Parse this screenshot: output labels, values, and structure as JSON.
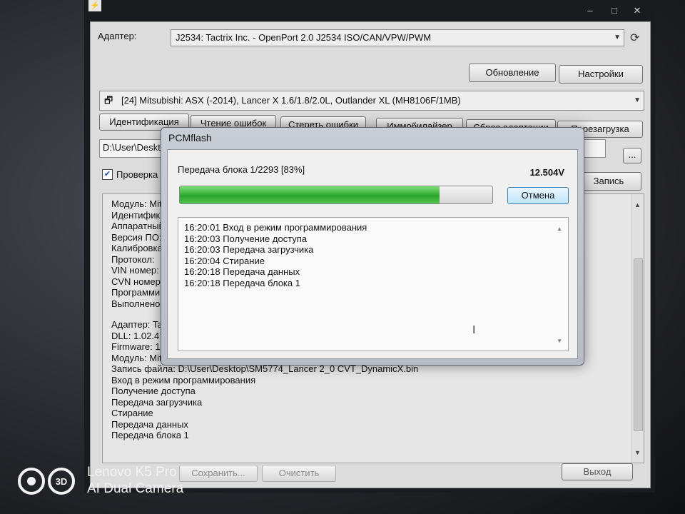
{
  "main": {
    "adapter_label": "Адаптер:",
    "adapter_value": "J2534: Tactrix Inc. - OpenPort 2.0 J2534 ISO/CAN/VPW/PWM",
    "update_button": "Обновление",
    "settings_button": "Настройки",
    "vehicle_value": "[24] Mitsubishi: ASX (-2014), Lancer X 1.6/1.8/2.0L, Outlander XL (MH8106F/1MB)",
    "tabs": [
      "Идентификация",
      "Чтение ошибок",
      "Стереть ошибки",
      "Иммобилайзер",
      "Сброс адаптации",
      "Перезагрузка"
    ],
    "path_value": "D:\\User\\Desktop",
    "browse_button": "...",
    "verify_checkbox_label": "Проверка",
    "write_button": "Запись",
    "log_lines_top": [
      "Модуль: Mits",
      "Идентифика",
      "Аппаратный",
      "Версия ПО:",
      "Калибровка:",
      "Протокол:",
      "VIN номер:",
      "CVN номер:",
      "Программиро",
      "Выполнено"
    ],
    "log_lines_bottom": [
      "Адаптер: Tac",
      "DLL: 1.02.479",
      "Firmware: 1.1",
      "Модуль: Mits",
      "Запись файла: D:\\User\\Desktop\\SM5774_Lancer 2_0 CVT_DynamicX.bin",
      "Вход в режим программирования",
      "Получение доступа",
      "Передача загрузчика",
      "Стирание",
      "Передача данных",
      "Передача блока 1"
    ],
    "save_button": "Сохранить...",
    "clear_button": "Очистить",
    "exit_button": "Выход"
  },
  "dialog": {
    "title": "PCMflash",
    "transfer_label": "Передача блока 1/2293 [83%]",
    "voltage": "12.504V",
    "progress_percent": 83,
    "cancel_button": "Отмена",
    "log": [
      "16:20:01 Вход в режим программирования",
      "16:20:03 Получение доступа",
      "16:20:03 Передача загрузчика",
      "16:20:04 Стирание",
      "16:20:18 Передача данных",
      "16:20:18 Передача блока 1"
    ]
  },
  "overlay": {
    "camera_line1": "Lenovo K5 Pro",
    "camera_line2": "AI Dual Camera",
    "logo_text": "3D"
  },
  "colors": {
    "progress_green": "#2aa52a",
    "cancel_accent": "#3c7fb1"
  }
}
